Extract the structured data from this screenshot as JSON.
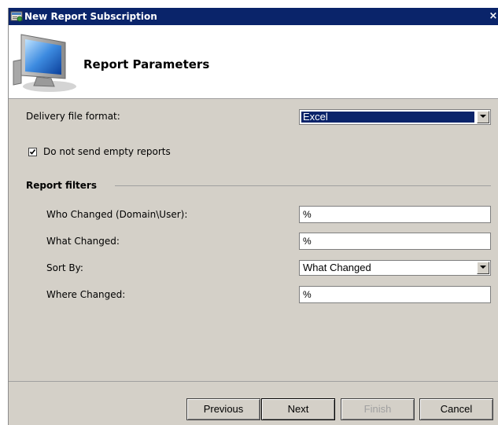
{
  "window": {
    "title": "New Report Subscription",
    "close_glyph": "×"
  },
  "header": {
    "heading": "Report Parameters",
    "icon": "computer-monitor-icon"
  },
  "form": {
    "delivery_format": {
      "label": "Delivery file format:",
      "value": "Excel"
    },
    "send_empty": {
      "label": "Do not send empty reports",
      "checked": true
    },
    "filters_section": {
      "title": "Report filters"
    },
    "who_changed": {
      "label": "Who Changed (Domain\\User):",
      "value": "%"
    },
    "what_changed": {
      "label": "What Changed:",
      "value": "%"
    },
    "sort_by": {
      "label": "Sort By:",
      "value": "What Changed"
    },
    "where_changed": {
      "label": "Where Changed:",
      "value": "%"
    }
  },
  "buttons": {
    "previous": "Previous",
    "next": "Next",
    "finish": "Finish",
    "cancel": "Cancel"
  },
  "colors": {
    "titlebar": "#0a246a",
    "dialog_bg": "#d4d0c8",
    "selection": "#0a246a"
  }
}
